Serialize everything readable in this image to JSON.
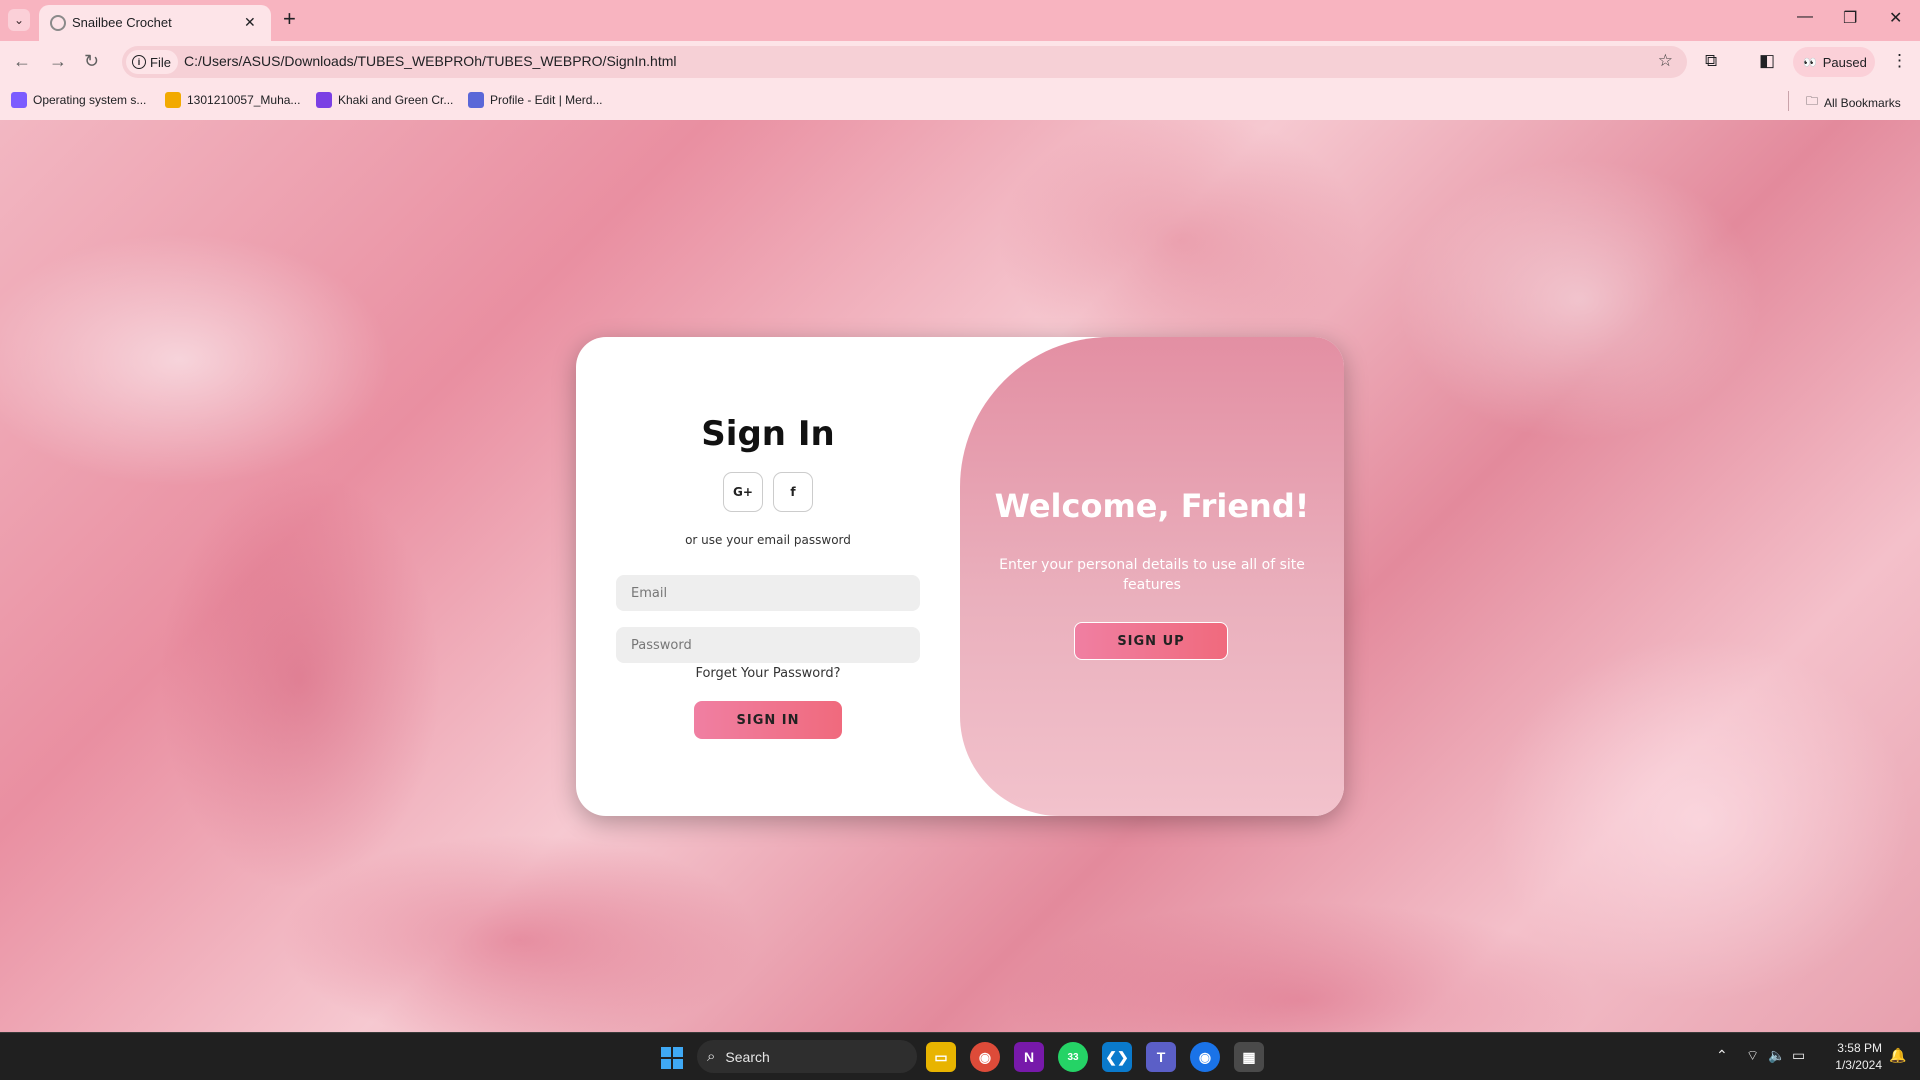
{
  "browser": {
    "tab_title": "Snailbee Crochet",
    "address_chip": "File",
    "url": "C:/Users/ASUS/Downloads/TUBES_WEBPROh/TUBES_WEBPRO/SignIn.html",
    "profile_status": "Paused",
    "bookmarks": [
      {
        "label": "Operating system s...",
        "icon": "purple-logo-icon",
        "color": "#7b5cff"
      },
      {
        "label": "1301210057_Muha...",
        "icon": "cc-logo-icon",
        "color": "#f2a900"
      },
      {
        "label": "Khaki and Green Cr...",
        "icon": "heart-logo-icon",
        "color": "#7b3fe4"
      },
      {
        "label": "Profile - Edit | Merd...",
        "icon": "grid-logo-icon",
        "color": "#5a67d8"
      }
    ],
    "all_bookmarks": "All Bookmarks"
  },
  "signin": {
    "title": "Sign In",
    "social_google": "G+",
    "social_facebook": "f",
    "alt_text": "or use your email password",
    "email_placeholder": "Email",
    "password_placeholder": "Password",
    "forgot": "Forget Your Password?",
    "button": "SIGN IN"
  },
  "welcome": {
    "title": "Welcome, Friend!",
    "text": "Enter your personal details to use all of site features",
    "button": "SIGN UP"
  },
  "taskbar": {
    "search": "Search",
    "time": "3:58 PM",
    "date": "1/3/2024",
    "whatsapp_badge": "33"
  },
  "colors": {
    "accent_start": "#f07fa2",
    "accent_end": "#f06a7d",
    "panel": "#e38fa3",
    "chrome": "#f8b4c0"
  }
}
